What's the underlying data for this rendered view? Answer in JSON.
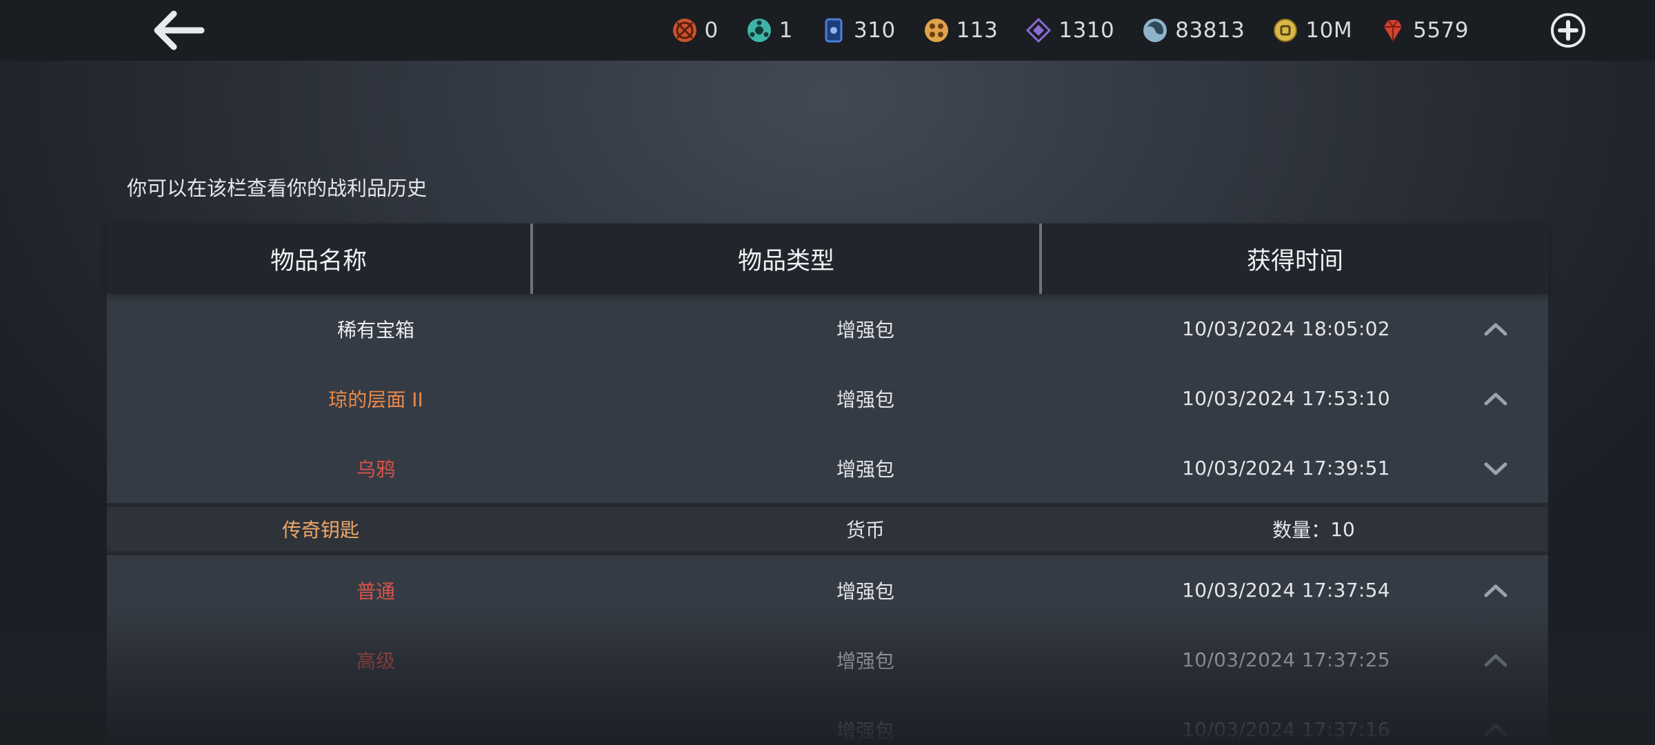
{
  "currencies": [
    {
      "icon": "orange-emblem-icon",
      "value": "0",
      "color": "#c9532b"
    },
    {
      "icon": "teal-emblem-icon",
      "value": "1",
      "color": "#3fb5a8"
    },
    {
      "icon": "blue-card-icon",
      "value": "310",
      "color": "#4a7fd6"
    },
    {
      "icon": "gold-emblem-icon",
      "value": "113",
      "color": "#e0a24a"
    },
    {
      "icon": "purple-diamond-icon",
      "value": "1310",
      "color": "#8a6bd6"
    },
    {
      "icon": "swirl-orb-icon",
      "value": "83813",
      "color": "#8fb4c9"
    },
    {
      "icon": "gold-coin-icon",
      "value": "10M",
      "color": "#d8b84a"
    },
    {
      "icon": "red-gem-icon",
      "value": "5579",
      "color": "#d0432f"
    }
  ],
  "subtitle": "你可以在该栏查看你的战利品历史",
  "table": {
    "headers": [
      "物品名称",
      "物品类型",
      "获得时间"
    ],
    "rows": [
      {
        "name": "稀有宝箱",
        "type": "增强包",
        "time": "10/03/2024 18:05:02",
        "chevron": "up",
        "rarity": "white"
      },
      {
        "name": "琼的层面 II",
        "type": "增强包",
        "time": "10/03/2024 17:53:10",
        "chevron": "up",
        "rarity": "orange"
      },
      {
        "name": "乌鸦",
        "type": "增强包",
        "time": "10/03/2024 17:39:51",
        "chevron": "down",
        "rarity": "red"
      },
      {
        "name": "普通",
        "type": "增强包",
        "time": "10/03/2024 17:37:54",
        "chevron": "up",
        "rarity": "red"
      },
      {
        "name": "高级",
        "type": "增强包",
        "time": "10/03/2024 17:37:25",
        "chevron": "up",
        "rarity": "red"
      },
      {
        "name": "",
        "type": "增强包",
        "time": "10/03/2024 17:37:16",
        "chevron": "up",
        "rarity": "red"
      }
    ],
    "expanded": {
      "name": "传奇钥匙",
      "type": "货币",
      "qty_label": "数量：",
      "qty": "10"
    }
  },
  "colors": {
    "rarity_white": "#eceef1",
    "rarity_orange": "#e88a4a",
    "rarity_red": "#d9534a",
    "sub_gold": "#f0a868"
  }
}
